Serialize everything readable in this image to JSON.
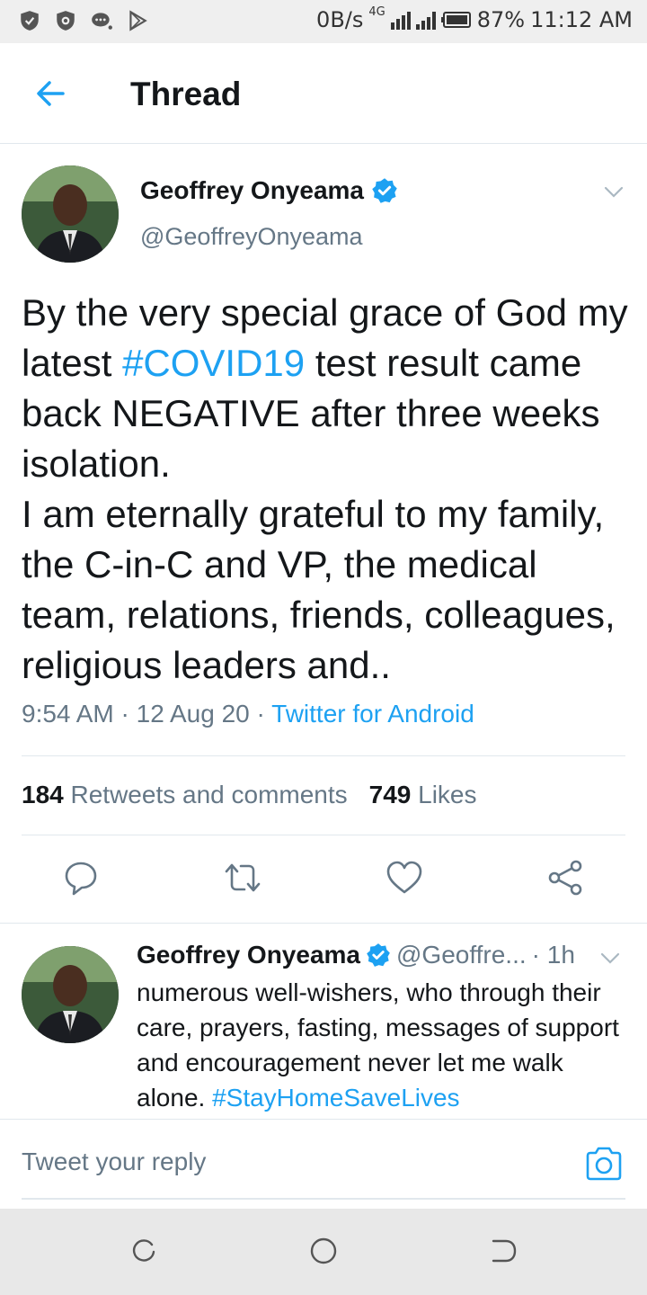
{
  "status_bar": {
    "left_icons": [
      "shield-icon",
      "vpn-icon",
      "chat-bubble-icon",
      "play-store-icon"
    ],
    "network_speed": "0B/s",
    "network_type": "4G",
    "battery": "87%",
    "time": "11:12 AM"
  },
  "header": {
    "back_icon": "arrow-left-icon",
    "title": "Thread"
  },
  "colors": {
    "accent": "#1da1f2",
    "text": "#14171a",
    "secondary": "#657786",
    "divider": "#e1e8ed"
  },
  "main_tweet": {
    "author_name": "Geoffrey Onyeama",
    "handle": "@GeoffreyOnyeama",
    "verified": true,
    "text_before": "By the very special grace of God my latest ",
    "hashtag": "#COVID19",
    "text_after": " test result came back NEGATIVE after three weeks isolation.\nI am eternally grateful to my family, the C-in-C and VP, the medical team, relations, friends, colleagues, religious leaders and..",
    "time": "9:54 AM",
    "sep1": " · ",
    "date": "12 Aug 20",
    "sep2": " · ",
    "source": "Twitter for Android",
    "retweets_count": "184",
    "retweets_label": "Retweets and comments",
    "likes_count": "749",
    "likes_label": "Likes",
    "actions": [
      "reply-icon",
      "retweet-icon",
      "like-icon",
      "share-icon"
    ]
  },
  "reply_tweet": {
    "author_name": "Geoffrey Onyeama",
    "handle": "@Geoffre...",
    "time": "· 1h",
    "text": "numerous well-wishers, who through their care, prayers, fasting, messages of support and encouragement never let me walk alone. ",
    "hashtag": "#StayHomeSaveLives"
  },
  "reply_box": {
    "placeholder": "Tweet your reply",
    "camera_icon": "camera-icon"
  },
  "nav_bar": {
    "buttons": [
      "recents-icon",
      "home-icon",
      "back-icon"
    ]
  }
}
